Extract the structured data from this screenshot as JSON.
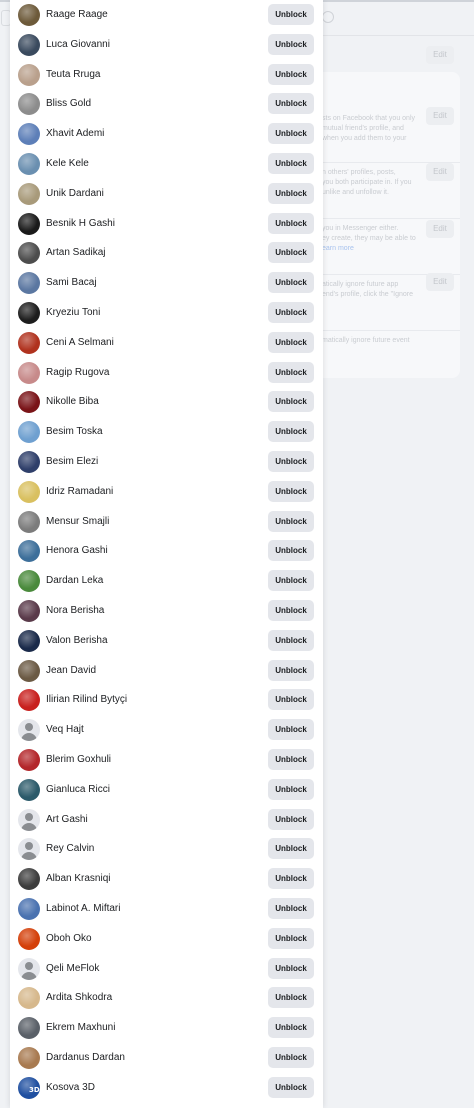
{
  "colors": {
    "page_bg": "#f0f2f5",
    "button_bg": "#e4e6eb",
    "text": "#1c1e21"
  },
  "background": {
    "edit_label": "Edit",
    "sections": [
      {
        "lines": [
          "sts on Facebook that you only",
          "mutual friend's profile, and",
          "when you add them to your"
        ]
      },
      {
        "lines": [
          "n others' profiles, posts,",
          "you both participate in. If you",
          "unlike and unfollow it."
        ]
      },
      {
        "lines": [
          "you in Messenger either.",
          "ey create, they may be able to"
        ],
        "link": "earn more"
      },
      {
        "lines": [
          "atically ignore future app",
          "end's profile, click the \"Ignore"
        ]
      },
      {
        "lines": [
          "matically ignore future event"
        ]
      }
    ]
  },
  "blocked_list": {
    "unblock_label": "Unblock",
    "users": [
      {
        "name": "Raage Raage",
        "avatar": "photo",
        "color": "#6d5a3a"
      },
      {
        "name": "Luca Giovanni",
        "avatar": "photo",
        "color": "#3a4a5e"
      },
      {
        "name": "Teuta Rruga",
        "avatar": "photo",
        "color": "#b9a08c"
      },
      {
        "name": "Bliss Gold",
        "avatar": "photo",
        "color": "#8c8c8c"
      },
      {
        "name": "Xhavit Ademi",
        "avatar": "photo",
        "color": "#5d7fb8"
      },
      {
        "name": "Kele Kele",
        "avatar": "photo",
        "color": "#6a8fb0"
      },
      {
        "name": "Unik Dardani",
        "avatar": "photo",
        "color": "#a89a7a"
      },
      {
        "name": "Besnik H Gashi",
        "avatar": "photo",
        "color": "#1a1a1a"
      },
      {
        "name": "Artan Sadikaj",
        "avatar": "photo",
        "color": "#4d4d4d"
      },
      {
        "name": "Sami Bacaj",
        "avatar": "photo",
        "color": "#5b77a1"
      },
      {
        "name": "Kryeziu Toni",
        "avatar": "photo",
        "color": "#1d1d1d"
      },
      {
        "name": "Ceni A Selmani",
        "avatar": "photo",
        "color": "#b0321e"
      },
      {
        "name": "Ragip Rugova",
        "avatar": "photo",
        "color": "#c78a8a"
      },
      {
        "name": "Nikolle Biba",
        "avatar": "photo",
        "color": "#7a1418"
      },
      {
        "name": "Besim Toska",
        "avatar": "photo",
        "color": "#6fa0d0"
      },
      {
        "name": "Besim Elezi",
        "avatar": "photo",
        "color": "#2f3f6a"
      },
      {
        "name": "Idriz Ramadani",
        "avatar": "photo",
        "color": "#d9c060"
      },
      {
        "name": "Mensur Smajli",
        "avatar": "photo",
        "color": "#7c7c7c"
      },
      {
        "name": "Henora Gashi",
        "avatar": "photo",
        "color": "#3d6f9a"
      },
      {
        "name": "Dardan Leka",
        "avatar": "photo",
        "color": "#4a8a3c"
      },
      {
        "name": "Nora Berisha",
        "avatar": "photo",
        "color": "#5a3a4a"
      },
      {
        "name": "Valon Berisha",
        "avatar": "photo",
        "color": "#1a2a4a"
      },
      {
        "name": "Jean David",
        "avatar": "photo",
        "color": "#6b5a44"
      },
      {
        "name": "Ilirian Rilind Bytyçi",
        "avatar": "photo",
        "color": "#c8201e"
      },
      {
        "name": "Veq Hajt",
        "avatar": "generic",
        "color": "#e4e6eb"
      },
      {
        "name": "Blerim Goxhuli",
        "avatar": "photo",
        "color": "#b3262a"
      },
      {
        "name": "Gianluca Ricci",
        "avatar": "photo",
        "color": "#2b5a6a"
      },
      {
        "name": "Art Gashi",
        "avatar": "generic",
        "color": "#e4e6eb"
      },
      {
        "name": "Rey Calvin",
        "avatar": "generic",
        "color": "#e4e6eb"
      },
      {
        "name": "Alban Krasniqi",
        "avatar": "photo",
        "color": "#3d3d3d"
      },
      {
        "name": "Labinot A. Miftari",
        "avatar": "photo",
        "color": "#4a72b0"
      },
      {
        "name": "Oboh Oko",
        "avatar": "photo",
        "color": "#d4400a"
      },
      {
        "name": "Qeli MeFlok",
        "avatar": "generic",
        "color": "#e4e6eb"
      },
      {
        "name": "Ardita Shkodra",
        "avatar": "photo",
        "color": "#d6b88c"
      },
      {
        "name": "Ekrem Maxhuni",
        "avatar": "photo",
        "color": "#5a6068"
      },
      {
        "name": "Dardanus Dardan",
        "avatar": "photo",
        "color": "#a87a50"
      },
      {
        "name": "Kosova 3D",
        "avatar": "badge",
        "color": "#1f4fa0",
        "badge_text": "3D"
      }
    ]
  }
}
